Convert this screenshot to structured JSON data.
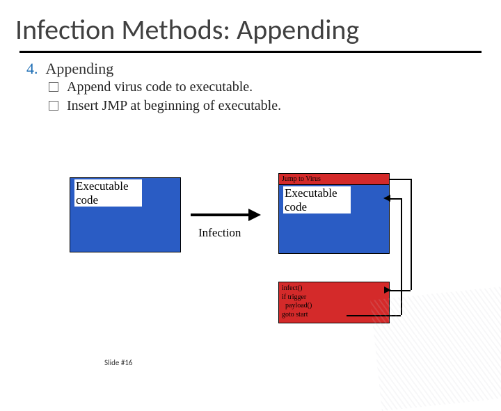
{
  "title": "Infection Methods: Appending",
  "list": {
    "num": "4.",
    "heading": "Appending",
    "bullets": [
      "Append virus code to executable.",
      "Insert JMP at beginning of executable."
    ]
  },
  "diagram": {
    "left_box": "Executable\ncode",
    "arrow_label": "Infection",
    "jump_label": "Jump to Virus",
    "right_box": "Executable\ncode",
    "virus_code": "infect()\nif trigger\n  payload()\ngoto start"
  },
  "footer": "Slide #16"
}
